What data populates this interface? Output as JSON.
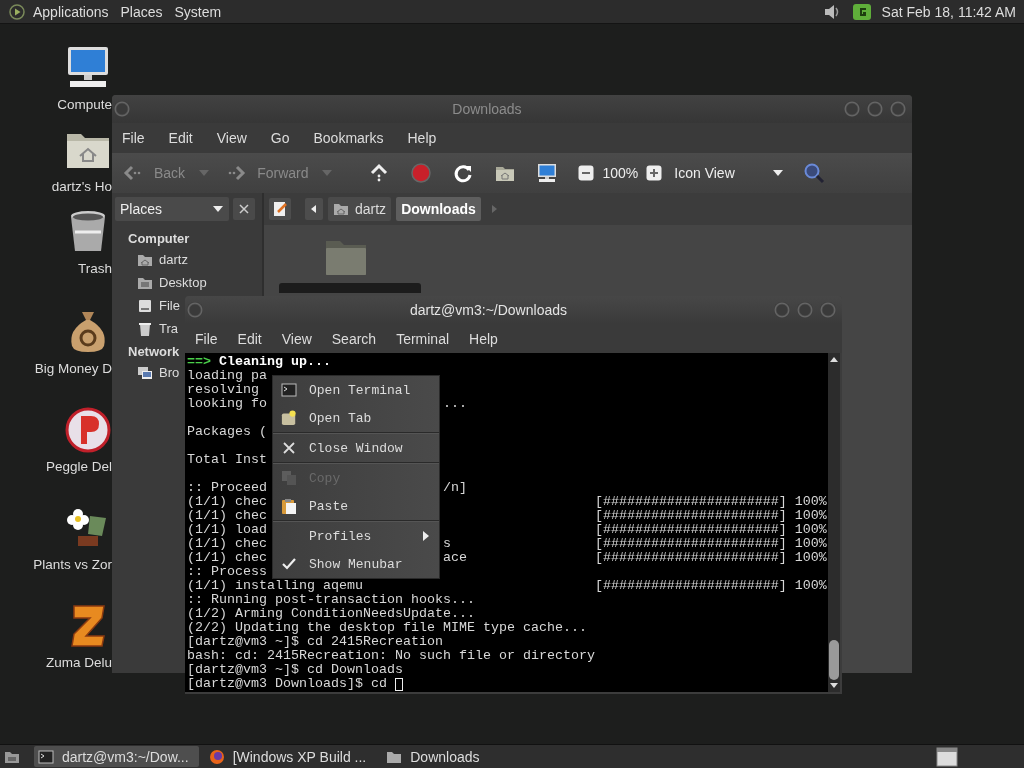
{
  "top_panel": {
    "menus": [
      "Applications",
      "Places",
      "System"
    ],
    "clock": "Sat Feb 18, 11:42 AM"
  },
  "desktop_icons": [
    {
      "label": "Compute",
      "kind": "computer"
    },
    {
      "label": "dartz's Ho",
      "kind": "home"
    },
    {
      "label": "Trash",
      "kind": "trash"
    },
    {
      "label": "Big Money D",
      "kind": "money"
    },
    {
      "label": "Peggle Del",
      "kind": "peggle"
    },
    {
      "label": "Plants vs Zor",
      "kind": "plants"
    },
    {
      "label": "Zuma Delu",
      "kind": "zuma"
    }
  ],
  "file_manager": {
    "title": "Downloads",
    "menus": [
      "File",
      "Edit",
      "View",
      "Go",
      "Bookmarks",
      "Help"
    ],
    "toolbar": {
      "back": {
        "label": "Back",
        "disabled": true
      },
      "forward": {
        "label": "Forward",
        "disabled": true
      },
      "zoom": "100%",
      "view": "Icon View"
    },
    "sidebar": {
      "dropdown": "Places",
      "sections": [
        {
          "heading": "Computer",
          "items": [
            {
              "label": "dartz",
              "kind": "home"
            },
            {
              "label": "Desktop",
              "kind": "desktop"
            },
            {
              "label": "File",
              "kind": "drive"
            },
            {
              "label": "Tra",
              "kind": "trash"
            }
          ]
        },
        {
          "heading": "Network",
          "items": [
            {
              "label": "Bro",
              "kind": "network"
            }
          ]
        }
      ]
    },
    "path": [
      {
        "label": "dartz",
        "selected": false
      },
      {
        "label": "Downloads",
        "selected": true
      }
    ]
  },
  "terminal": {
    "title": "dartz@vm3:~/Downloads",
    "menus": [
      "File",
      "Edit",
      "View",
      "Search",
      "Terminal",
      "Help"
    ],
    "lines": [
      {
        "kind": "heading",
        "arrow": "==>",
        "text": "Cleaning up..."
      },
      {
        "kind": "output",
        "text": "loading pa"
      },
      {
        "kind": "output",
        "text": "resolving"
      },
      {
        "kind": "output",
        "text": "looking fo",
        "tail": "..."
      },
      {
        "kind": "blank"
      },
      {
        "kind": "output",
        "text": "Packages ("
      },
      {
        "kind": "blank"
      },
      {
        "kind": "output",
        "text": "Total Inst"
      },
      {
        "kind": "blank"
      },
      {
        "kind": "output",
        "text": ":: Proceed",
        "tail": "/n]"
      },
      {
        "kind": "output",
        "text": "(1/1) chec",
        "progress": "[######################] 100%"
      },
      {
        "kind": "output",
        "text": "(1/1) chec",
        "progress": "[######################] 100%"
      },
      {
        "kind": "output",
        "text": "(1/1) load",
        "progress": "[######################] 100%"
      },
      {
        "kind": "output",
        "text": "(1/1) chec",
        "tail": "s",
        "progress": "[######################] 100%"
      },
      {
        "kind": "output",
        "text": "(1/1) chec",
        "tail": "ace",
        "progress": "[######################] 100%"
      },
      {
        "kind": "output",
        "text": ":: Process"
      },
      {
        "kind": "output",
        "text": "(1/1) installing aqemu",
        "progress": "[######################] 100%"
      },
      {
        "kind": "output",
        "text": ":: Running post-transaction hooks..."
      },
      {
        "kind": "output",
        "text": "(1/2) Arming ConditionNeedsUpdate..."
      },
      {
        "kind": "output",
        "text": "(2/2) Updating the desktop file MIME type cache..."
      },
      {
        "kind": "output",
        "text": "[dartz@vm3 ~]$ cd 2415Recreation"
      },
      {
        "kind": "output",
        "text": "bash: cd: 2415Recreation: No such file or directory"
      },
      {
        "kind": "output",
        "text": "[dartz@vm3 ~]$ cd Downloads"
      },
      {
        "kind": "output",
        "text": "[dartz@vm3 Downloads]$ cd",
        "cursor": true
      }
    ]
  },
  "context_menu": {
    "items": [
      {
        "kind": "terminal",
        "label": "Open Terminal",
        "disabled": false,
        "checked": false
      },
      {
        "kind": "tab",
        "label": "Open Tab",
        "disabled": false,
        "checked": false
      },
      {
        "kind": "separator"
      },
      {
        "kind": "close",
        "label": "Close Window",
        "disabled": false,
        "checked": false
      },
      {
        "kind": "separator"
      },
      {
        "kind": "copy",
        "label": "Copy",
        "disabled": true,
        "checked": false
      },
      {
        "kind": "paste",
        "label": "Paste",
        "disabled": false,
        "checked": false
      },
      {
        "kind": "separator"
      },
      {
        "kind": "submenu",
        "label": "Profiles",
        "disabled": false,
        "checked": false
      },
      {
        "kind": "toggle",
        "label": "Show Menubar",
        "disabled": false,
        "checked": true
      }
    ]
  },
  "taskbar": {
    "tasks": [
      {
        "kind": "terminal",
        "label": "dartz@vm3:~/Dow...",
        "selected": true
      },
      {
        "kind": "browser",
        "label": "[Windows XP Build ...",
        "selected": false
      },
      {
        "kind": "folder",
        "label": "Downloads",
        "selected": false
      }
    ]
  }
}
